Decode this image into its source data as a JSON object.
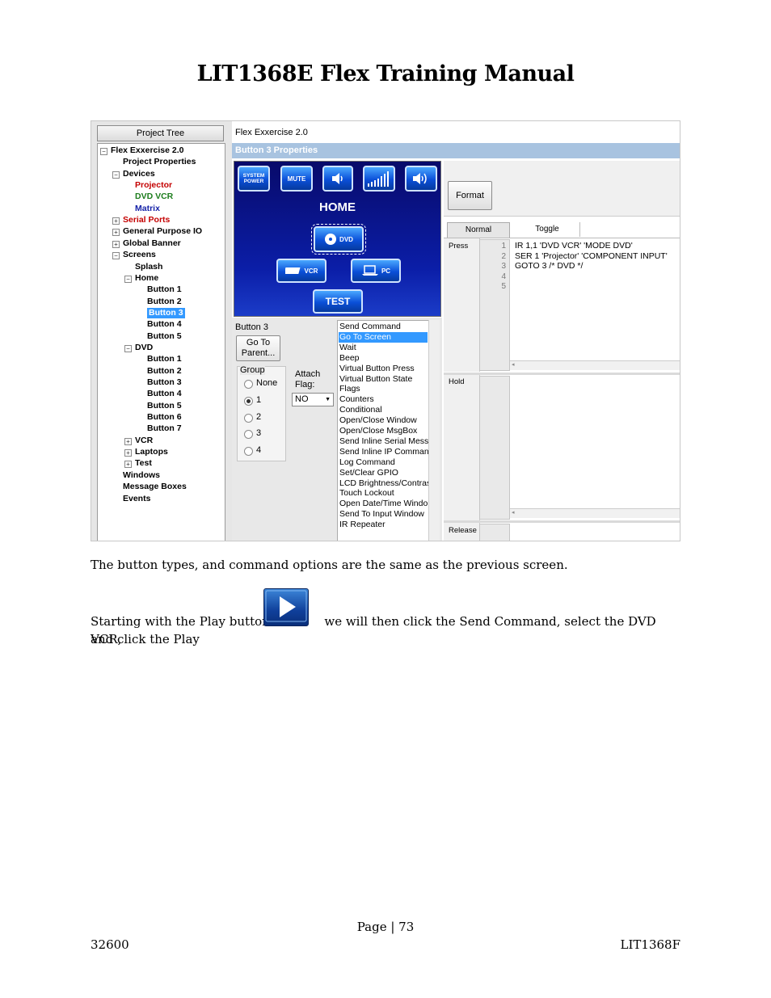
{
  "document": {
    "title": "LIT1368E Flex Training Manual",
    "paragraph1": "The button types, and command options are the same as the previous screen.",
    "paragraph2_before": "Starting with the Play button",
    "paragraph2_after": "we will then click the Send Command, select the DVD VCR,",
    "paragraph2_line2": "and click the Play",
    "page_label": "Page | 73",
    "footer_left": "32600",
    "footer_right": "LIT1368F"
  },
  "screenshot": {
    "tree_title": "Project Tree",
    "tree": [
      {
        "label": "Flex Exxercise 2.0",
        "color": "black"
      },
      {
        "label": "Project Properties",
        "color": "black"
      },
      {
        "label": "Devices",
        "color": "black"
      },
      {
        "label": "Projector",
        "color": "red"
      },
      {
        "label": "DVD VCR",
        "color": "green"
      },
      {
        "label": "Matrix",
        "color": "blue"
      },
      {
        "label": "Serial Ports",
        "color": "red"
      },
      {
        "label": "General Purpose IO",
        "color": "black"
      },
      {
        "label": "Global Banner",
        "color": "black"
      },
      {
        "label": "Screens",
        "color": "black"
      },
      {
        "label": "Splash",
        "color": "black"
      },
      {
        "label": "Home",
        "color": "black"
      },
      {
        "label": "Button 1",
        "color": "black"
      },
      {
        "label": "Button 2",
        "color": "black"
      },
      {
        "label": "Button 3",
        "color": "black",
        "selected": true
      },
      {
        "label": "Button 4",
        "color": "black"
      },
      {
        "label": "Button 5",
        "color": "black"
      },
      {
        "label": "DVD",
        "color": "black"
      },
      {
        "label": "Button 1",
        "color": "black"
      },
      {
        "label": "Button 2",
        "color": "black"
      },
      {
        "label": "Button 3",
        "color": "black"
      },
      {
        "label": "Button 4",
        "color": "black"
      },
      {
        "label": "Button 5",
        "color": "black"
      },
      {
        "label": "Button 6",
        "color": "black"
      },
      {
        "label": "Button 7",
        "color": "black"
      },
      {
        "label": "VCR",
        "color": "black"
      },
      {
        "label": "Laptops",
        "color": "black"
      },
      {
        "label": "Test",
        "color": "black"
      },
      {
        "label": "Windows",
        "color": "black"
      },
      {
        "label": "Message Boxes",
        "color": "black"
      },
      {
        "label": "Events",
        "color": "black"
      }
    ],
    "project_label": "Flex Exxercise 2.0",
    "properties_header": "Button 3 Properties",
    "screen": {
      "buttons": {
        "system_power": "SYSTEM POWER",
        "mute": "MUTE",
        "dvd": "DVD",
        "vcr": "VCR",
        "pc": "PC",
        "test": "TEST"
      },
      "home_title": "HOME"
    },
    "button_name": "Button 3",
    "goto_parent": "Go To Parent...",
    "group_label": "Group",
    "group_options": [
      "None",
      "1",
      "2",
      "3",
      "4"
    ],
    "group_selected": "1",
    "attach_flag_label": "Attach Flag:",
    "attach_flag_value": "NO",
    "commands": [
      "Send Command",
      "Go To Screen",
      "Wait",
      "Beep",
      "Virtual Button Press",
      "Virtual Button State",
      "Flags",
      "Counters",
      "Conditional",
      "Open/Close Window",
      "Open/Close MsgBox",
      "Send Inline Serial Mess",
      "Send Inline IP Comman",
      "Log Command",
      "Set/Clear GPIO",
      "LCD Brightness/Contras",
      "Touch Lockout",
      "Open Date/Time Windo",
      "Send To Input Window",
      "IR Repeater"
    ],
    "selected_command": "Go To Screen",
    "format_button": "Format",
    "tabs": {
      "normal": "Normal",
      "toggle": "Toggle"
    },
    "sections": {
      "press": "Press",
      "hold": "Hold",
      "release": "Release"
    },
    "line_numbers": [
      "1",
      "2",
      "3",
      "4",
      "5"
    ],
    "press_code": [
      "IR 1,1 'DVD VCR' 'MODE DVD'",
      "SER 1 'Projector' 'COMPONENT INPUT'",
      "GOTO 3 /* DVD */"
    ]
  }
}
